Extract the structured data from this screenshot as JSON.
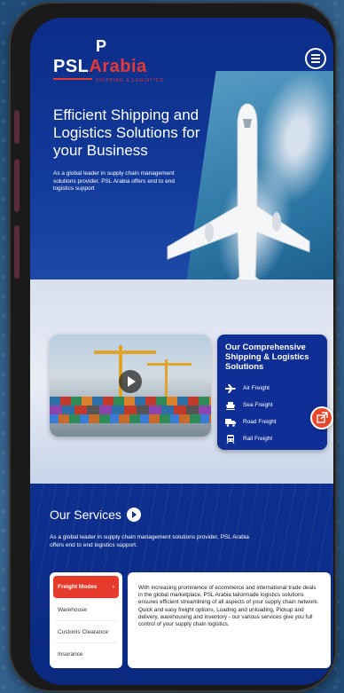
{
  "brand": {
    "logo_mark": "P",
    "logo_main": "PSL",
    "logo_accent": "Arabia",
    "tagline": "SHIPPING & LOGISTICS"
  },
  "hero": {
    "title": "Efficient Shipping and Logistics Solutions for your Business",
    "description": "As a global leader in supply chain management solutions provider. PSL Arabia offers end to end logistics support"
  },
  "solutions_card": {
    "title": "Our Comprehensive Shipping & Logistics Solutions",
    "items": [
      {
        "label": "Air Freight",
        "icon": "airplane-icon"
      },
      {
        "label": "Sea Freight",
        "icon": "ship-icon"
      },
      {
        "label": "Road Freight",
        "icon": "truck-icon"
      },
      {
        "label": "Rail Freight",
        "icon": "train-icon"
      }
    ]
  },
  "services": {
    "title": "Our Services",
    "description": "As a global leader in supply chain management solutions provider, PSL Arabia offers end to end logistics support.",
    "tabs": [
      {
        "label": "Freight Modes",
        "active": true
      },
      {
        "label": "Warehouse",
        "active": false
      },
      {
        "label": "Customs Clearance",
        "active": false
      },
      {
        "label": "Insurance",
        "active": false
      }
    ],
    "active_tab_arrow": "›",
    "panel_text": "With increasing prominence of ecommerce and international trade deals in the global marketplace, PSL Arabia tailormade logistics solutions ensures efficient streamlining of all aspects of your supply chain network. Quick and easy freight options, Loading and unloading, Pickup and delivery, warehousing and inventory - our various services give you full control of your supply chain logistics."
  },
  "colors": {
    "primary_blue": "#0f2f96",
    "accent_red": "#e53a2c",
    "white": "#ffffff"
  }
}
